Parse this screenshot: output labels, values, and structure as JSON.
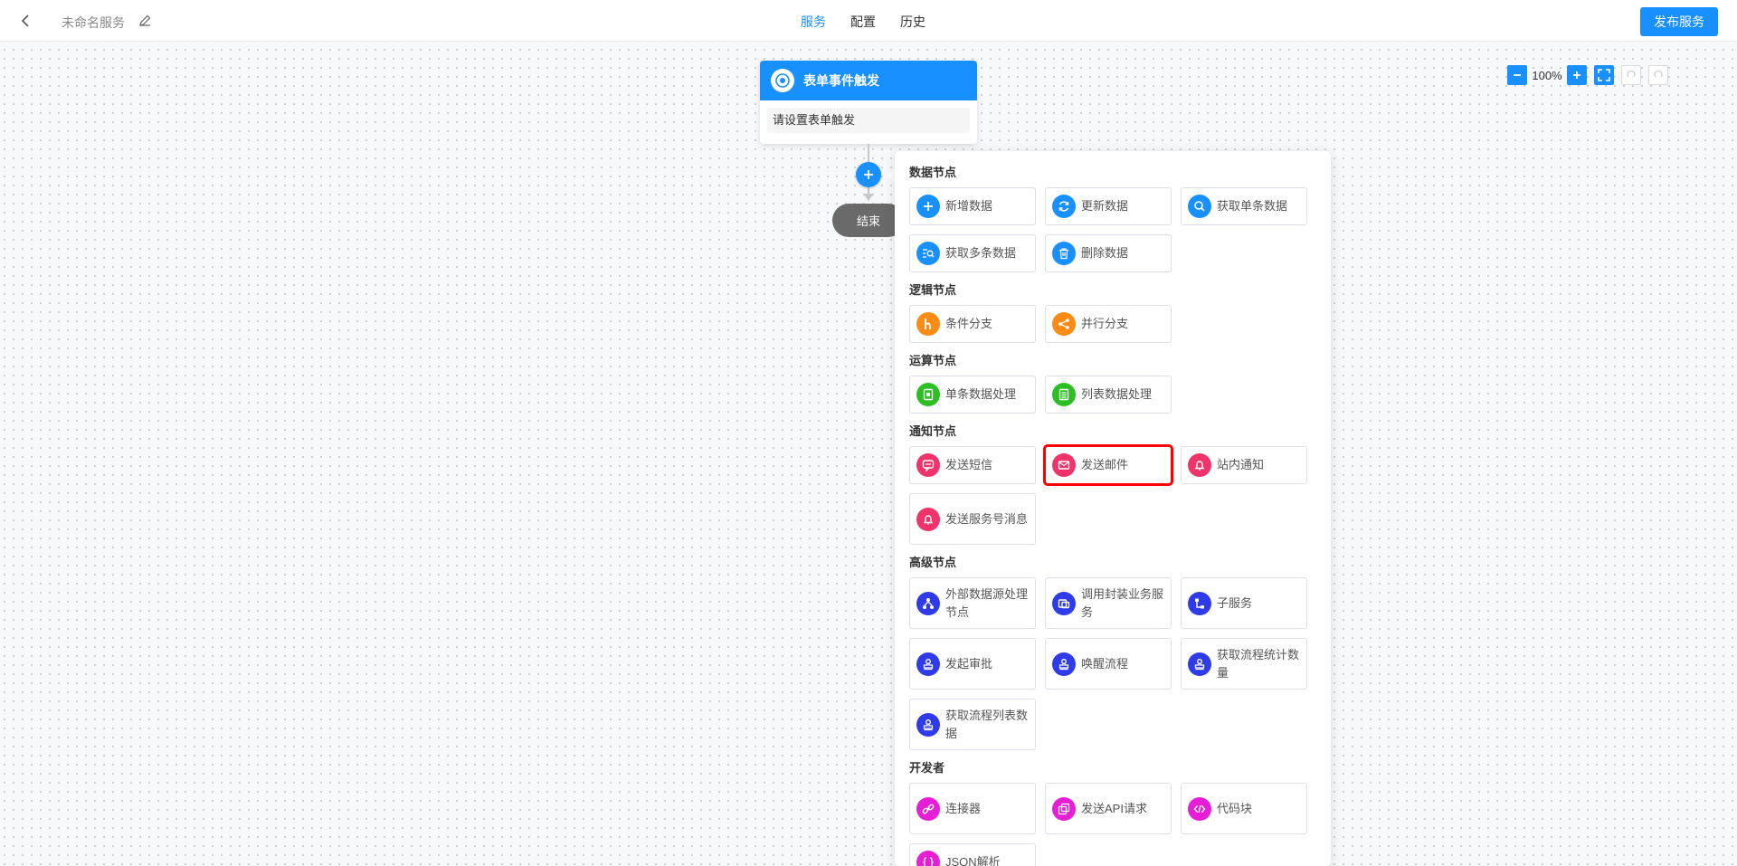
{
  "header": {
    "service_name": "未命名服务",
    "tabs": [
      {
        "label": "服务",
        "active": true
      },
      {
        "label": "配置",
        "active": false
      },
      {
        "label": "历史",
        "active": false
      }
    ],
    "publish_label": "发布服务"
  },
  "zoom": {
    "level": "100%"
  },
  "flow": {
    "trigger_title": "表单事件触发",
    "trigger_body": "请设置表单触发",
    "end_label": "结束"
  },
  "panel": {
    "sections": [
      {
        "title": "数据节点",
        "items": [
          {
            "label": "新增数据",
            "icon": "plus-icon",
            "color": "#1890ff"
          },
          {
            "label": "更新数据",
            "icon": "refresh-icon",
            "color": "#1890ff"
          },
          {
            "label": "获取单条数据",
            "icon": "search-icon",
            "color": "#1890ff"
          },
          {
            "label": "获取多条数据",
            "icon": "list-search-icon",
            "color": "#1890ff"
          },
          {
            "label": "删除数据",
            "icon": "trash-icon",
            "color": "#1890ff"
          }
        ]
      },
      {
        "title": "逻辑节点",
        "items": [
          {
            "label": "条件分支",
            "icon": "branch-icon",
            "color": "#fa8c16"
          },
          {
            "label": "并行分支",
            "icon": "parallel-icon",
            "color": "#fa8c16"
          }
        ]
      },
      {
        "title": "运算节点",
        "items": [
          {
            "label": "单条数据处理",
            "icon": "record-icon",
            "color": "#2bbf24"
          },
          {
            "label": "列表数据处理",
            "icon": "document-icon",
            "color": "#2bbf24"
          }
        ]
      },
      {
        "title": "通知节点",
        "items": [
          {
            "label": "发送短信",
            "icon": "message-icon",
            "color": "#f0336b"
          },
          {
            "label": "发送邮件",
            "icon": "mail-icon",
            "color": "#f0336b"
          },
          {
            "label": "站内通知",
            "icon": "bell-icon",
            "color": "#f0336b"
          },
          {
            "label": "发送服务号消息",
            "icon": "bell-icon",
            "color": "#f0336b"
          }
        ]
      },
      {
        "title": "高级节点",
        "items": [
          {
            "label": "外部数据源处理节点",
            "icon": "datasource-icon",
            "color": "#2f3be8"
          },
          {
            "label": "调用封装业务服务",
            "icon": "service-call-icon",
            "color": "#2f3be8"
          },
          {
            "label": "子服务",
            "icon": "sub-service-icon",
            "color": "#2f3be8"
          },
          {
            "label": "发起审批",
            "icon": "stamp-icon",
            "color": "#2f3be8"
          },
          {
            "label": "唤醒流程",
            "icon": "stamp-icon",
            "color": "#2f3be8"
          },
          {
            "label": "获取流程统计数量",
            "icon": "stamp-icon",
            "color": "#2f3be8"
          },
          {
            "label": "获取流程列表数据",
            "icon": "stamp-icon",
            "color": "#2f3be8"
          }
        ]
      },
      {
        "title": "开发者",
        "items": [
          {
            "label": "连接器",
            "icon": "link-icon",
            "color": "#e61fd6"
          },
          {
            "label": "发送API请求",
            "icon": "api-icon",
            "color": "#e61fd6"
          },
          {
            "label": "代码块",
            "icon": "code-icon",
            "color": "#e61fd6"
          },
          {
            "label": "JSON解析",
            "icon": "json-icon",
            "color": "#e61fd6"
          }
        ]
      }
    ]
  }
}
